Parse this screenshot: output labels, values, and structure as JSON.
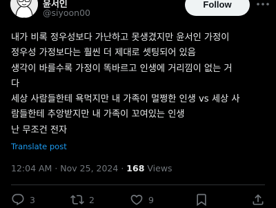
{
  "author": {
    "display_name": "윤서인",
    "handle": "@siyoon00",
    "follow_label": "Follow"
  },
  "tweet": {
    "lines": [
      "내가 비록 정우성보다 가난하고 못생겼지만 윤서인 가정이",
      "정우성 가정보다는 훨씬 더 제대로 셋팅되어 있음",
      "생각이 바를수록 가정이 똑바르고 인생에 거리낌이 없는 거",
      "다",
      "세상 사람들한테 욕먹지만 내 가족이 멀쩡한 인생 vs 세상 사",
      "람들한테 추앙받지만 내 가족이 꼬여있는 인생",
      "난 무조건 전자"
    ],
    "translate_label": "Translate post",
    "time": "12:04 AM",
    "date": "Nov 25, 2024",
    "separator": "·",
    "views_count": "168",
    "views_label": "Views"
  },
  "actions": {
    "replies": "3",
    "reposts": "2",
    "likes": "9"
  },
  "icons": {
    "reply": "reply-icon",
    "repost": "repost-icon",
    "like": "heart-icon",
    "bookmark": "bookmark-icon",
    "share": "share-icon",
    "more": "more-icon"
  },
  "colors": {
    "background": "#000000",
    "text": "#e7e9ea",
    "secondary": "#71767b",
    "link": "#1d9bf0",
    "follow_bg": "#eff3f4"
  }
}
